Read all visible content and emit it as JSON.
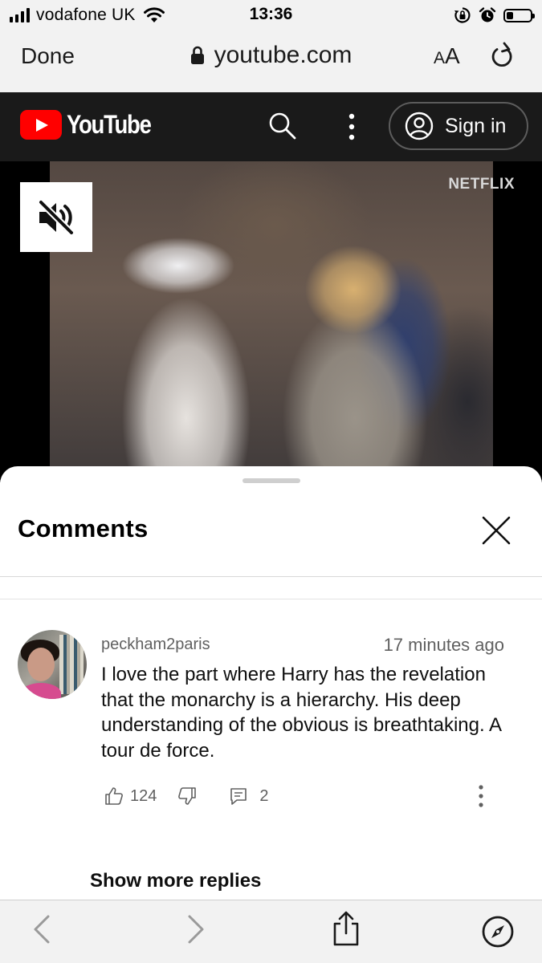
{
  "status_bar": {
    "carrier": "vodafone UK",
    "time": "13:36"
  },
  "safari": {
    "done_label": "Done",
    "url": "youtube.com",
    "text_size_label_small": "A",
    "text_size_label_large": "A"
  },
  "youtube_header": {
    "logo_text": "YouTube",
    "sign_in_label": "Sign in"
  },
  "video": {
    "watermark": "NETFLIX"
  },
  "comments_panel": {
    "title": "Comments",
    "comment": {
      "author": "peckham2paris",
      "time": "17 minutes ago",
      "text": "I love the part where Harry has the revelation that the monarchy is a hierarchy. His deep understanding of the obvious is breathtaking. A tour de force.",
      "likes": "124",
      "replies": "2"
    },
    "show_more_label": "Show more replies"
  },
  "colors": {
    "youtube_red": "#ff0000",
    "header_bg": "#1a1a1a",
    "safari_bar_bg": "#f2f2f2"
  }
}
